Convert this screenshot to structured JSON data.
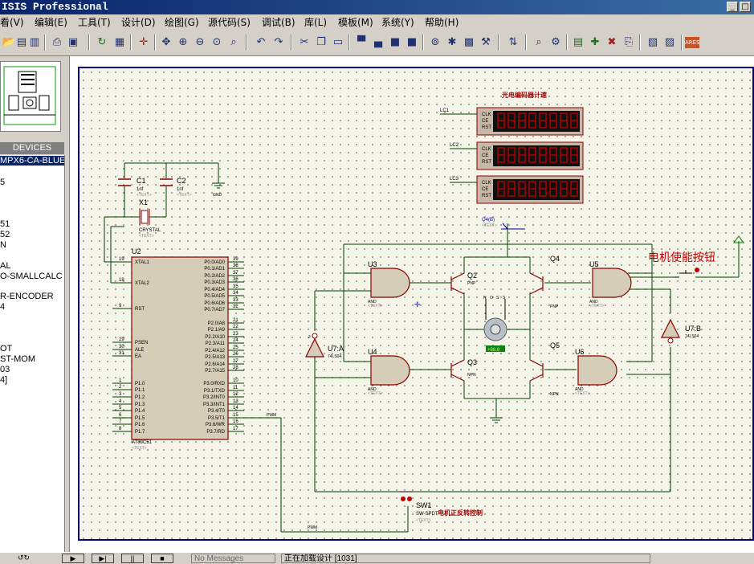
{
  "window": {
    "title": "ISIS Professional",
    "controls": [
      "_",
      "□"
    ]
  },
  "menu": [
    "看(V)",
    "编辑(E)",
    "工具(T)",
    "设计(D)",
    "绘图(G)",
    "源代码(S)",
    "调试(B)",
    "库(L)",
    "模板(M)",
    "系统(Y)",
    "帮助(H)"
  ],
  "toolbar_icons": [
    "open-icon",
    "save-icon",
    "import-icon",
    "export-icon",
    "print-icon",
    "print-area-icon",
    "refresh-icon",
    "grid-icon",
    "origin-icon",
    "pan-icon",
    "zoom-in-icon",
    "zoom-out-icon",
    "zoom-all-icon",
    "zoom-area-icon",
    "undo-icon",
    "redo-icon",
    "cut-icon",
    "copy-icon",
    "paste-icon",
    "block-copy-icon",
    "block-move-icon",
    "block-rotate-icon",
    "block-delete-icon",
    "pick-device-icon",
    "make-device-icon",
    "packaging-icon",
    "decompose-icon",
    "wire-autorouter-icon",
    "search-icon",
    "property-assign-icon",
    "new-sheet-icon",
    "remove-sheet-icon",
    "goto-sheet-icon",
    "bom-icon",
    "erc-icon",
    "netlist-icon",
    "ares-icon"
  ],
  "devices": {
    "header": "DEVICES",
    "items": [
      "MPX6-CA-BLUE",
      "5",
      "51",
      "52",
      "N",
      "AL",
      "O-SMALLCALC",
      "R-ENCODER",
      "4",
      "OT",
      "ST-MOM",
      "03",
      "4]"
    ]
  },
  "schematic": {
    "display_label": "光电编码器计速",
    "displays": [
      {
        "ref": "LC1",
        "pins": [
          "CLK",
          "CE",
          "RST"
        ]
      },
      {
        "ref": "LC2",
        "pins": [
          "CLK",
          "CE",
          "RST"
        ]
      },
      {
        "ref": "LC3",
        "pins": [
          "CLK",
          "CE",
          "RST"
        ]
      }
    ],
    "c1": {
      "ref": "C1",
      "value": "1nf",
      "text": "<TEXT>"
    },
    "c2": {
      "ref": "C2",
      "value": "1nf",
      "text": "<TEXT>"
    },
    "gnd": "GND",
    "x1": {
      "ref": "X1",
      "value": "CRYSTAL",
      "text": "<TEXT>"
    },
    "u2": {
      "ref": "U2",
      "part": "AT89C51",
      "text": "<TEXT>",
      "left_pins": [
        {
          "num": "19",
          "name": "XTAL1"
        },
        {
          "num": "18",
          "name": "XTAL2"
        },
        {
          "num": "9",
          "name": "RST"
        },
        {
          "num": "29",
          "name": "PSEN"
        },
        {
          "num": "30",
          "name": "ALE"
        },
        {
          "num": "31",
          "name": "EA"
        },
        {
          "num": "1",
          "name": "P1.0"
        },
        {
          "num": "2",
          "name": "P1.1"
        },
        {
          "num": "3",
          "name": "P1.2"
        },
        {
          "num": "4",
          "name": "P1.3"
        },
        {
          "num": "5",
          "name": "P1.4"
        },
        {
          "num": "6",
          "name": "P1.5"
        },
        {
          "num": "7",
          "name": "P1.6"
        },
        {
          "num": "8",
          "name": "P1.7"
        }
      ],
      "right_pins": [
        {
          "num": "39",
          "name": "P0.0/AD0"
        },
        {
          "num": "38",
          "name": "P0.1/AD1"
        },
        {
          "num": "37",
          "name": "P0.2/AD2"
        },
        {
          "num": "36",
          "name": "P0.3/AD3"
        },
        {
          "num": "35",
          "name": "P0.4/AD4"
        },
        {
          "num": "34",
          "name": "P0.5/AD5"
        },
        {
          "num": "33",
          "name": "P0.6/AD6"
        },
        {
          "num": "32",
          "name": "P0.7/AD7"
        },
        {
          "num": "21",
          "name": "P2.0/A8"
        },
        {
          "num": "22",
          "name": "P2.1/A9"
        },
        {
          "num": "23",
          "name": "P2.2/A10"
        },
        {
          "num": "24",
          "name": "P2.3/A11"
        },
        {
          "num": "25",
          "name": "P2.4/A12"
        },
        {
          "num": "26",
          "name": "P2.5/A13"
        },
        {
          "num": "27",
          "name": "P2.6/A14"
        },
        {
          "num": "28",
          "name": "P2.7/A15"
        },
        {
          "num": "10",
          "name": "P3.0/RXD"
        },
        {
          "num": "11",
          "name": "P3.1/TXD"
        },
        {
          "num": "12",
          "name": "P3.2/INT0"
        },
        {
          "num": "13",
          "name": "P3.3/INT1"
        },
        {
          "num": "14",
          "name": "P3.4/T0"
        },
        {
          "num": "15",
          "name": "P3.5/T1"
        },
        {
          "num": "16",
          "name": "P3.6/WR"
        },
        {
          "num": "17",
          "name": "P3.7/RD"
        }
      ]
    },
    "pwm_label": "PWM",
    "gates": [
      {
        "ref": "U3",
        "type": "AND"
      },
      {
        "ref": "U4",
        "type": "AND"
      },
      {
        "ref": "U5",
        "type": "AND"
      },
      {
        "ref": "U6",
        "type": "AND"
      }
    ],
    "inverters": [
      {
        "ref": "U7:A",
        "part": "74LS04",
        "pin": "2"
      },
      {
        "ref": "U7:B",
        "part": "74LS04"
      }
    ],
    "transistors": [
      {
        "ref": "Q2",
        "type": "PNP"
      },
      {
        "ref": "Q3",
        "type": "NPN"
      },
      {
        "ref": "Q4",
        "type": "PNP"
      },
      {
        "ref": "Q5",
        "type": "NPN"
      }
    ],
    "q4_net": "Q4(B)",
    "motor_label": "+88.8",
    "motor_pins": [
      "N",
      "O",
      "S",
      "S"
    ],
    "enable_label": "电机使能按钮",
    "sw1": {
      "ref": "SW1",
      "part": "SW-SPDT",
      "label": "电机正反转控制",
      "text": "<TEXT>"
    },
    "text_placeholder": "<TEXT>"
  },
  "statusbar": {
    "buttons": [
      "▶",
      "▶|",
      "||",
      "■"
    ],
    "messages": "No Messages",
    "status": "正在加载设计 [1031]"
  }
}
